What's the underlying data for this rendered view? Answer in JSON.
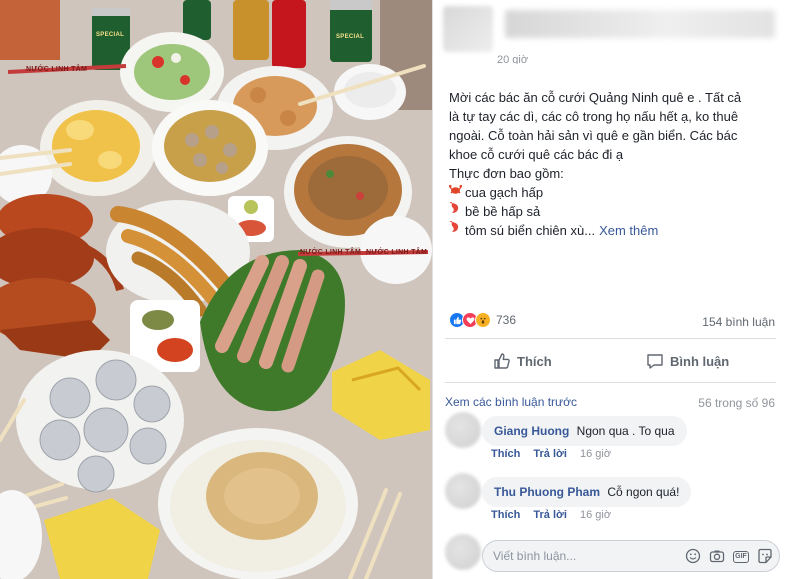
{
  "post": {
    "time": "20 giờ",
    "lines": [
      "Mời các bác ăn cỗ cưới Quảng Ninh quê e . Tất cả",
      "là tự tay các dì, các cô trong họ nấu hết ạ, ko thuê",
      "ngoài. Cỗ toàn hải sản vì quê e gần biển. Các bác",
      "khoe cỗ cưới quê các bác đi ạ",
      "Thực đơn bao gồm:"
    ],
    "menu": [
      {
        "icon": "crab-emoji",
        "text": "cua gạch hấp"
      },
      {
        "icon": "shrimp-emoji",
        "text": "bề bề hấp sả"
      },
      {
        "icon": "shrimp-emoji",
        "text": "tôm sú biển chiên xù..."
      }
    ],
    "see_more": "Xem thêm"
  },
  "reactions": {
    "count": "736",
    "comments": "154 bình luận"
  },
  "actions": {
    "like": "Thích",
    "comment": "Bình luận"
  },
  "comments_header": {
    "prev": "Xem các bình luận trước",
    "page": "56 trong số 96"
  },
  "comments": [
    {
      "name": "Giang Huong",
      "text": "Ngon qua . To qua",
      "like": "Thích",
      "reply": "Trả lời",
      "time": "16 giờ"
    },
    {
      "name": "Thu Phuong Pham",
      "text": "Cỗ ngon quá!",
      "like": "Thích",
      "reply": "Trả lời",
      "time": "16 giờ"
    }
  ],
  "write": {
    "placeholder": "Viết bình luận..."
  },
  "photo": {
    "labels": [
      "NƯỚC LINH TÂM",
      "NƯỚC LINH TÂM",
      "NƯỚC LINH TÂM"
    ],
    "can_text": "SPECIAL"
  }
}
